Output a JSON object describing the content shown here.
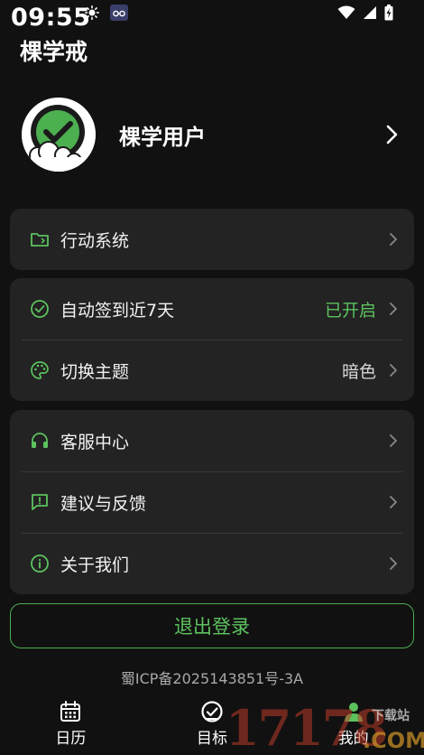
{
  "status_bar": {
    "time": "09:55",
    "icons": [
      "brightness-icon",
      "glasses-icon",
      "wifi-icon",
      "cell-signal-icon",
      "battery-charging-icon"
    ]
  },
  "app": {
    "title": "棵学戒"
  },
  "profile": {
    "name": "棵学用户"
  },
  "sections": {
    "action": {
      "label": "行动系统"
    },
    "auto_checkin": {
      "label": "自动签到近7天",
      "value": "已开启"
    },
    "theme": {
      "label": "切换主题",
      "value": "暗色"
    },
    "support": {
      "label": "客服中心"
    },
    "feedback": {
      "label": "建议与反馈"
    },
    "about": {
      "label": "关于我们"
    }
  },
  "logout": {
    "label": "退出登录"
  },
  "icp": {
    "text": "蜀ICP备2025143851号-3A"
  },
  "nav": {
    "calendar": "日历",
    "goals": "目标",
    "mine": "我的"
  },
  "watermark": {
    "number": "17178",
    "site": "下载站",
    "domain": ".COM"
  },
  "colors": {
    "background": "#111111",
    "card": "#232323",
    "accent": "#5cc25e"
  }
}
